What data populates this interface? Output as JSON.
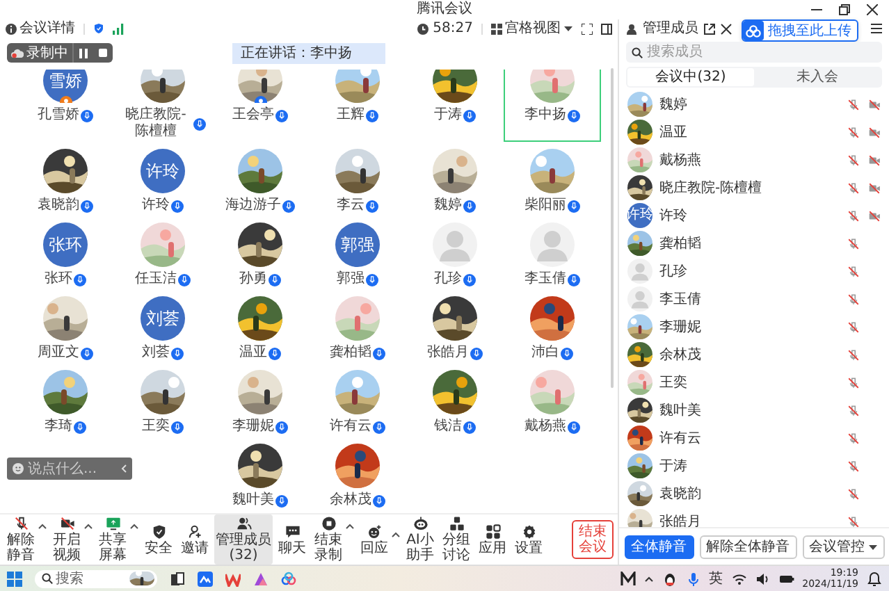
{
  "window": {
    "title": "腾讯会议"
  },
  "topbar": {
    "details": "会议详情",
    "timer": "58:27",
    "view": "宫格视图"
  },
  "recording": {
    "label": "录制中"
  },
  "speaking_banner": "正在讲话：李中扬",
  "chat_input": {
    "placeholder": "说点什么..."
  },
  "participants": [
    {
      "name": "孔雪娇",
      "kind": "text",
      "avatar_text": "雪娇",
      "host": true,
      "cohost": false,
      "speaking": false
    },
    {
      "name": "晓庄教院-陈檀檀",
      "kind": "picture",
      "host": false,
      "cohost": false,
      "speaking": false
    },
    {
      "name": "王会亭",
      "kind": "picture",
      "host": false,
      "cohost": true,
      "speaking": false
    },
    {
      "name": "王辉",
      "kind": "picture",
      "host": false,
      "cohost": false,
      "speaking": false
    },
    {
      "name": "于涛",
      "kind": "picture",
      "host": false,
      "cohost": false,
      "speaking": false
    },
    {
      "name": "李中扬",
      "kind": "picture",
      "host": false,
      "cohost": false,
      "speaking": true
    },
    {
      "name": "袁晓韵",
      "kind": "picture",
      "host": false,
      "cohost": false,
      "speaking": false
    },
    {
      "name": "许玲",
      "kind": "text",
      "avatar_text": "许玲",
      "host": false,
      "cohost": false,
      "speaking": false
    },
    {
      "name": "海边游子",
      "kind": "picture",
      "host": false,
      "cohost": false,
      "speaking": false
    },
    {
      "name": "李云",
      "kind": "picture",
      "host": false,
      "cohost": false,
      "speaking": false
    },
    {
      "name": "魏婷",
      "kind": "picture",
      "host": false,
      "cohost": false,
      "speaking": false
    },
    {
      "name": "柴阳丽",
      "kind": "picture",
      "host": false,
      "cohost": false,
      "speaking": false
    },
    {
      "name": "张环",
      "kind": "text",
      "avatar_text": "张环",
      "host": false,
      "cohost": false,
      "speaking": false
    },
    {
      "name": "任玉洁",
      "kind": "picture",
      "host": false,
      "cohost": false,
      "speaking": false
    },
    {
      "name": "孙勇",
      "kind": "picture",
      "host": false,
      "cohost": false,
      "speaking": false
    },
    {
      "name": "郭强",
      "kind": "text",
      "avatar_text": "郭强",
      "host": false,
      "cohost": false,
      "speaking": false
    },
    {
      "name": "孔珍",
      "kind": "default",
      "host": false,
      "cohost": false,
      "speaking": false
    },
    {
      "name": "李玉倩",
      "kind": "default",
      "host": false,
      "cohost": false,
      "speaking": false
    },
    {
      "name": "周亚文",
      "kind": "picture",
      "host": false,
      "cohost": false,
      "speaking": false
    },
    {
      "name": "刘荟",
      "kind": "text",
      "avatar_text": "刘荟",
      "host": false,
      "cohost": false,
      "speaking": false
    },
    {
      "name": "温亚",
      "kind": "picture",
      "host": false,
      "cohost": false,
      "speaking": false
    },
    {
      "name": "龚柏韬",
      "kind": "picture",
      "host": false,
      "cohost": false,
      "speaking": false
    },
    {
      "name": "张皓月",
      "kind": "picture",
      "host": false,
      "cohost": false,
      "speaking": false
    },
    {
      "name": "沛白",
      "kind": "picture",
      "host": false,
      "cohost": false,
      "speaking": false
    },
    {
      "name": "李琦",
      "kind": "picture",
      "host": false,
      "cohost": false,
      "speaking": false
    },
    {
      "name": "王奕",
      "kind": "picture",
      "host": false,
      "cohost": false,
      "speaking": false
    },
    {
      "name": "李珊妮",
      "kind": "picture",
      "host": false,
      "cohost": false,
      "speaking": false
    },
    {
      "name": "许有云",
      "kind": "picture",
      "host": false,
      "cohost": false,
      "speaking": false
    },
    {
      "name": "钱洁",
      "kind": "picture",
      "host": false,
      "cohost": false,
      "speaking": false
    },
    {
      "name": "戴杨燕",
      "kind": "picture",
      "host": false,
      "cohost": false,
      "speaking": false
    },
    {
      "name": "魏叶美",
      "kind": "picture",
      "host": false,
      "cohost": false,
      "speaking": false
    },
    {
      "name": "余林茂",
      "kind": "picture",
      "host": false,
      "cohost": false,
      "speaking": false
    }
  ],
  "toolbar": {
    "items": [
      {
        "kind": "mic",
        "label": "解除静音",
        "menu": true,
        "selected": false
      },
      {
        "kind": "camera",
        "label": "开启视频",
        "menu": true,
        "selected": false
      },
      {
        "kind": "share",
        "label": "共享屏幕",
        "menu": true,
        "selected": false
      },
      {
        "kind": "shield",
        "label": "安全",
        "menu": false,
        "selected": false
      },
      {
        "kind": "invite",
        "label": "邀请",
        "menu": false,
        "selected": false
      },
      {
        "kind": "members",
        "label": "管理成员(32)",
        "menu": false,
        "selected": true
      },
      {
        "kind": "chat",
        "label": "聊天",
        "menu": false,
        "selected": false
      },
      {
        "kind": "record",
        "label": "结束录制",
        "menu": true,
        "selected": false
      },
      {
        "kind": "react",
        "label": "回应",
        "menu": true,
        "selected": false
      },
      {
        "kind": "ai",
        "label": "AI小助手",
        "menu": false,
        "selected": false
      },
      {
        "kind": "breakout",
        "label": "分组讨论",
        "menu": false,
        "selected": false
      },
      {
        "kind": "apps",
        "label": "应用",
        "menu": false,
        "selected": false
      },
      {
        "kind": "settings",
        "label": "设置",
        "menu": false,
        "selected": false
      }
    ],
    "end_button": "结束会议"
  },
  "panel": {
    "title": "管理成员",
    "upload_hint": "拖拽至此上传",
    "search_placeholder": "搜索成员",
    "tabs": [
      {
        "label": "会议中(32)",
        "selected": true
      },
      {
        "label": "未入会",
        "selected": false
      }
    ],
    "members": [
      {
        "name": "魏婷",
        "kind": "picture",
        "mic_muted": true,
        "camera_off": true
      },
      {
        "name": "温亚",
        "kind": "picture",
        "mic_muted": true,
        "camera_off": true
      },
      {
        "name": "戴杨燕",
        "kind": "picture",
        "mic_muted": true,
        "camera_off": true
      },
      {
        "name": "晓庄教院-陈檀檀",
        "kind": "picture",
        "mic_muted": true,
        "camera_off": true
      },
      {
        "name": "许玲",
        "kind": "text",
        "avatar_text": "许玲",
        "mic_muted": true,
        "camera_off": true
      },
      {
        "name": "龚柏韬",
        "kind": "picture",
        "mic_muted": true,
        "camera_off": false
      },
      {
        "name": "孔珍",
        "kind": "default",
        "mic_muted": true,
        "camera_off": false
      },
      {
        "name": "李玉倩",
        "kind": "default",
        "mic_muted": true,
        "camera_off": false
      },
      {
        "name": "李珊妮",
        "kind": "picture",
        "mic_muted": true,
        "camera_off": false
      },
      {
        "name": "余林茂",
        "kind": "picture",
        "mic_muted": true,
        "camera_off": false
      },
      {
        "name": "王奕",
        "kind": "picture",
        "mic_muted": true,
        "camera_off": false
      },
      {
        "name": "魏叶美",
        "kind": "picture",
        "mic_muted": true,
        "camera_off": false
      },
      {
        "name": "许有云",
        "kind": "picture",
        "mic_muted": true,
        "camera_off": false
      },
      {
        "name": "于涛",
        "kind": "picture",
        "mic_muted": true,
        "camera_off": false
      },
      {
        "name": "袁晓韵",
        "kind": "picture",
        "mic_muted": true,
        "camera_off": false
      },
      {
        "name": "张皓月",
        "kind": "picture",
        "mic_muted": true,
        "camera_off": false
      }
    ],
    "buttons": [
      "全体静音",
      "解除全体静音",
      "会议管控"
    ]
  },
  "taskbar": {
    "search_placeholder": "搜索",
    "input_method": "英",
    "time": "19:19",
    "date": "2024/11/19"
  }
}
